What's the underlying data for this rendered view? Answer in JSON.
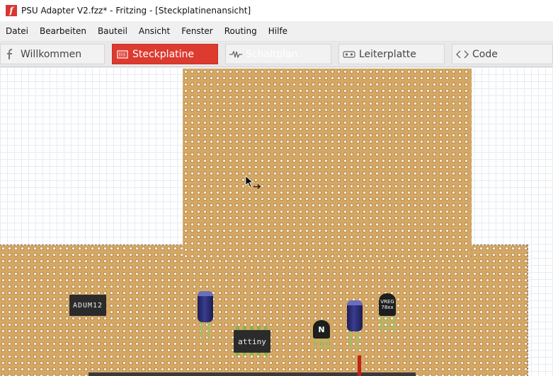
{
  "window": {
    "title": "PSU Adapter V2.fzz* - Fritzing - [Steckplatinenansicht]",
    "app_icon": "fritzing-f-icon",
    "app_icon_glyph": "f"
  },
  "menu": [
    "Datei",
    "Bearbeiten",
    "Bauteil",
    "Ansicht",
    "Fenster",
    "Routing",
    "Hilfe"
  ],
  "tabs": [
    {
      "label": "Willkommen",
      "icon": "fritzing-icon",
      "state": "normal"
    },
    {
      "label": "Steckplatine",
      "icon": "breadboard-icon",
      "state": "active"
    },
    {
      "label": "Schaltplan",
      "icon": "schematic-icon",
      "state": "normal"
    },
    {
      "label": "Leiterplatte",
      "icon": "pcb-icon",
      "state": "normal"
    },
    {
      "label": "Code",
      "icon": "code-icon",
      "state": "normal"
    }
  ],
  "components": {
    "adum_label": "ADUM12",
    "attiny_label": "attiny",
    "mosfet_label": "N",
    "vreg_label_1": "VREG",
    "vreg_label_2": "78xx"
  },
  "colors": {
    "accent": "#dd3b30",
    "board": "#d4a864",
    "grid": "#e6ecf3",
    "capacitor": "#2b2e7a",
    "wire": "#c0241c"
  }
}
